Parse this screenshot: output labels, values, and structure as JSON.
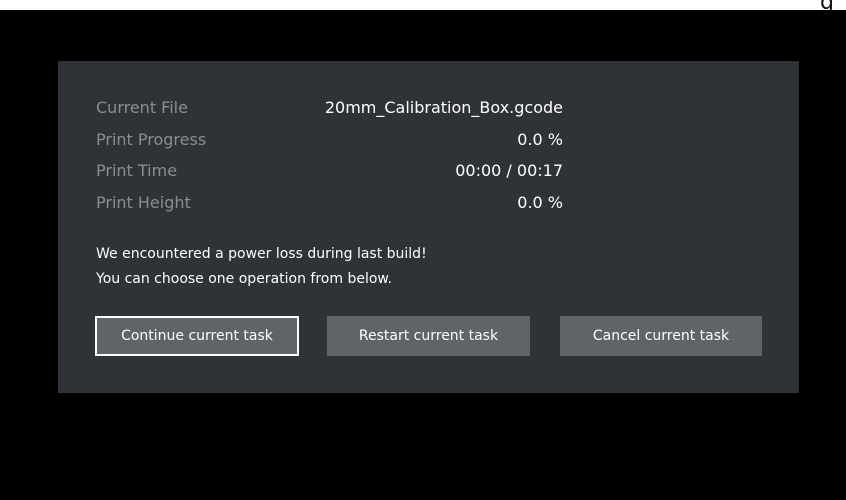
{
  "colors": {
    "screen_background": "#000000",
    "top_strip": "#ffffff",
    "dialog_background": "#2f3236",
    "label_text": "#8a8e93",
    "value_text": "#ffffff",
    "button_background": "#606368",
    "focused_button_border": "#ffffff"
  },
  "top_strip": {
    "partial_glyph": "g"
  },
  "info": [
    {
      "label": "Current File",
      "value": "20mm_Calibration_Box.gcode"
    },
    {
      "label": "Print Progress",
      "value": "0.0 %"
    },
    {
      "label": "Print Time",
      "value": "00:00 / 00:17"
    },
    {
      "label": "Print Height",
      "value": "0.0 %"
    }
  ],
  "message": {
    "line1": "We encountered a power loss during last build!",
    "line2": "You can choose one operation from below."
  },
  "buttons": {
    "continue": "Continue current task",
    "restart": "Restart current task",
    "cancel": "Cancel current task",
    "focused": "continue"
  }
}
